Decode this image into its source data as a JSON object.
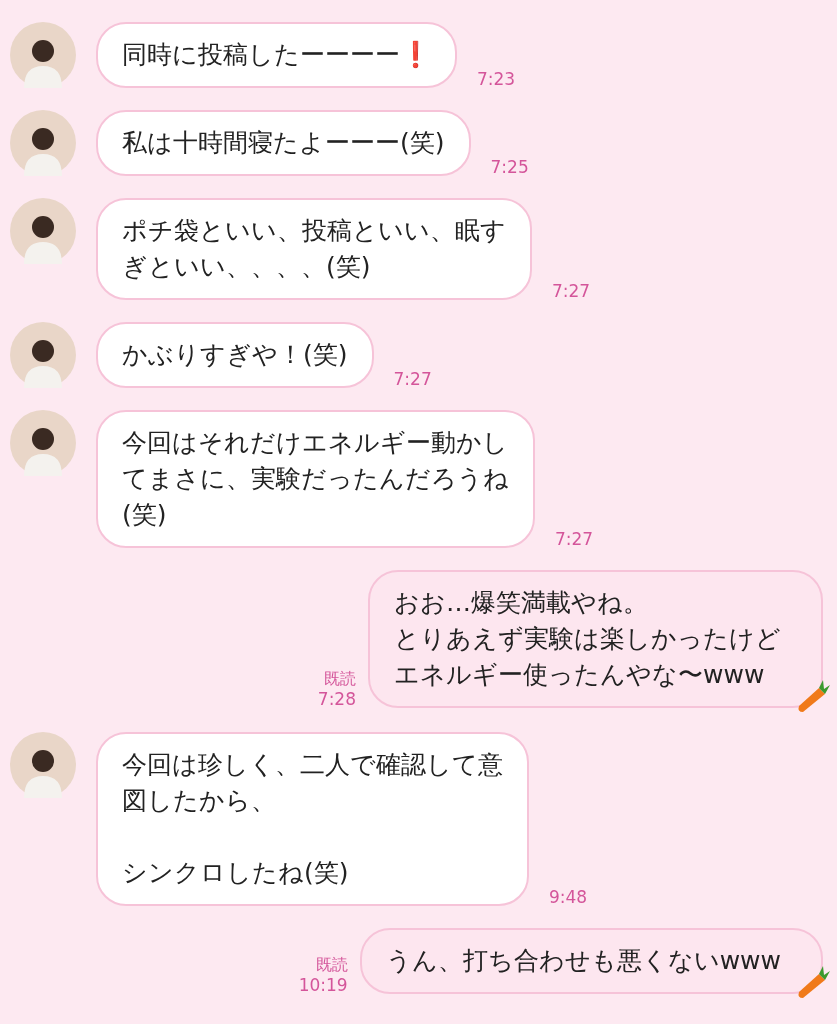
{
  "messages": [
    {
      "kind": "received",
      "paragraphs": [
        [
          "同時に投稿したーーーー❗️"
        ]
      ],
      "time": "7:23"
    },
    {
      "kind": "received",
      "paragraphs": [
        [
          "私は十時間寝たよーーー(笑)"
        ]
      ],
      "time": "7:25"
    },
    {
      "kind": "received",
      "paragraphs": [
        [
          "ポチ袋といい、投稿といい、眠す",
          "ぎといい、、、、(笑)"
        ]
      ],
      "time": "7:27"
    },
    {
      "kind": "received",
      "paragraphs": [
        [
          "かぶりすぎや！(笑)"
        ]
      ],
      "time": "7:27"
    },
    {
      "kind": "received",
      "paragraphs": [
        [
          "今回はそれだけエネルギー動かし",
          "てまさに、実験だったんだろうね",
          "(笑)"
        ]
      ],
      "time": "7:27"
    },
    {
      "kind": "sent",
      "paragraphs": [
        [
          "おお…爆笑満載やね。",
          "とりあえず実験は楽しかったけど",
          "エネルギー使ったんやな〜www"
        ]
      ],
      "read": "既読",
      "time": "7:28"
    },
    {
      "kind": "received",
      "paragraphs": [
        [
          "今回は珍しく、二人で確認して意",
          "図したから、"
        ],
        [
          "シンクロしたね(笑)"
        ]
      ],
      "time": "9:48"
    },
    {
      "kind": "sent",
      "paragraphs": [
        [
          "うん、打ち合わせも悪くないwww"
        ]
      ],
      "read": "既読",
      "time": "10:19"
    }
  ]
}
